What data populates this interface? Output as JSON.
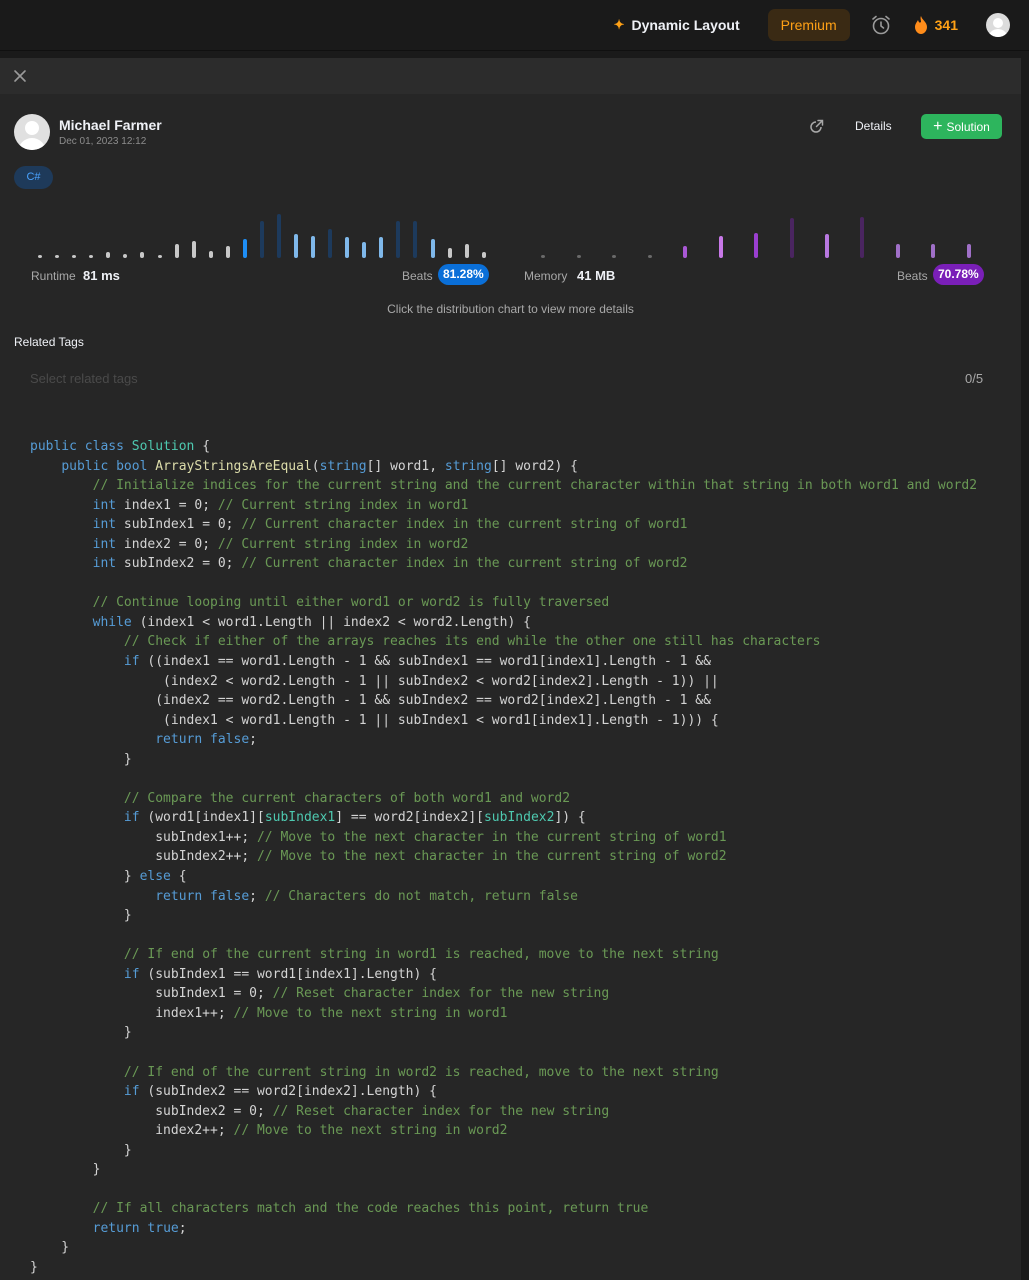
{
  "topbar": {
    "dynamic_layout": "Dynamic Layout",
    "premium": "Premium",
    "streak": "341"
  },
  "submission": {
    "author": "Michael Farmer",
    "date": "Dec 01, 2023 12:12",
    "details_label": "Details",
    "solution_label": "Solution",
    "language": "C#"
  },
  "stats": {
    "runtime_label": "Runtime",
    "runtime_value": "81 ms",
    "runtime_beats_label": "Beats",
    "runtime_beats": "81.28%",
    "memory_label": "Memory",
    "memory_value": "41 MB",
    "memory_beats_label": "Beats",
    "memory_beats": "70.78%",
    "hint": "Click the distribution chart to view more details"
  },
  "colors": {
    "runtime_accent": "#0a84ff",
    "memory_accent": "#8b2fd6",
    "solution_green": "#2db55d",
    "premium_orange": "#ffa116"
  },
  "related_tags": {
    "label": "Related Tags",
    "placeholder": "Select related tags",
    "count": "0/5"
  },
  "code_lines": [
    [
      [
        "kw",
        "public"
      ],
      [
        "p",
        " "
      ],
      [
        "kw",
        "class"
      ],
      [
        "p",
        " "
      ],
      [
        "ty",
        "Solution"
      ],
      [
        "p",
        " {"
      ]
    ],
    [
      [
        "p",
        "    "
      ],
      [
        "kw",
        "public"
      ],
      [
        "p",
        " "
      ],
      [
        "kw",
        "bool"
      ],
      [
        "p",
        " "
      ],
      [
        "fn",
        "ArrayStringsAreEqual"
      ],
      [
        "p",
        "("
      ],
      [
        "kw",
        "string"
      ],
      [
        "p",
        "[] word1, "
      ],
      [
        "kw",
        "string"
      ],
      [
        "p",
        "[] word2) {"
      ]
    ],
    [
      [
        "p",
        "        "
      ],
      [
        "cm",
        "// Initialize indices for the current string and the current character within that string in both word1 and word2"
      ]
    ],
    [
      [
        "p",
        "        "
      ],
      [
        "kw",
        "int"
      ],
      [
        "p",
        " index1 = 0; "
      ],
      [
        "cm",
        "// Current string index in word1"
      ]
    ],
    [
      [
        "p",
        "        "
      ],
      [
        "kw",
        "int"
      ],
      [
        "p",
        " subIndex1 = 0; "
      ],
      [
        "cm",
        "// Current character index in the current string of word1"
      ]
    ],
    [
      [
        "p",
        "        "
      ],
      [
        "kw",
        "int"
      ],
      [
        "p",
        " index2 = 0; "
      ],
      [
        "cm",
        "// Current string index in word2"
      ]
    ],
    [
      [
        "p",
        "        "
      ],
      [
        "kw",
        "int"
      ],
      [
        "p",
        " subIndex2 = 0; "
      ],
      [
        "cm",
        "// Current character index in the current string of word2"
      ]
    ],
    [
      [
        "p",
        ""
      ]
    ],
    [
      [
        "p",
        "        "
      ],
      [
        "cm",
        "// Continue looping until either word1 or word2 is fully traversed"
      ]
    ],
    [
      [
        "p",
        "        "
      ],
      [
        "kw",
        "while"
      ],
      [
        "p",
        " (index1 < word1.Length || index2 < word2.Length) {"
      ]
    ],
    [
      [
        "p",
        "            "
      ],
      [
        "cm",
        "// Check if either of the arrays reaches its end while the other one still has characters"
      ]
    ],
    [
      [
        "p",
        "            "
      ],
      [
        "kw",
        "if"
      ],
      [
        "p",
        " ((index1 == word1.Length - 1 && subIndex1 == word1[index1].Length - 1 &&"
      ]
    ],
    [
      [
        "p",
        "                 (index2 < word2.Length - 1 || subIndex2 < word2[index2].Length - 1)) ||"
      ]
    ],
    [
      [
        "p",
        "                (index2 == word2.Length - 1 && subIndex2 == word2[index2].Length - 1 &&"
      ]
    ],
    [
      [
        "p",
        "                 (index1 < word1.Length - 1 || subIndex1 < word1[index1].Length - 1))) {"
      ]
    ],
    [
      [
        "p",
        "                "
      ],
      [
        "kw",
        "return"
      ],
      [
        "p",
        " "
      ],
      [
        "kw",
        "false"
      ],
      [
        "p",
        ";"
      ]
    ],
    [
      [
        "p",
        "            }"
      ]
    ],
    [
      [
        "p",
        ""
      ]
    ],
    [
      [
        "p",
        "            "
      ],
      [
        "cm",
        "// Compare the current characters of both word1 and word2"
      ]
    ],
    [
      [
        "p",
        "            "
      ],
      [
        "kw",
        "if"
      ],
      [
        "p",
        " (word1[index1]["
      ],
      [
        "hl",
        "subIndex1"
      ],
      [
        "p",
        "] == word2[index2]["
      ],
      [
        "hl",
        "subIndex2"
      ],
      [
        "p",
        "]) {"
      ]
    ],
    [
      [
        "p",
        "                subIndex1++; "
      ],
      [
        "cm",
        "// Move to the next character in the current string of word1"
      ]
    ],
    [
      [
        "p",
        "                subIndex2++; "
      ],
      [
        "cm",
        "// Move to the next character in the current string of word2"
      ]
    ],
    [
      [
        "p",
        "            } "
      ],
      [
        "kw",
        "else"
      ],
      [
        "p",
        " {"
      ]
    ],
    [
      [
        "p",
        "                "
      ],
      [
        "kw",
        "return"
      ],
      [
        "p",
        " "
      ],
      [
        "kw",
        "false"
      ],
      [
        "p",
        "; "
      ],
      [
        "cm",
        "// Characters do not match, return false"
      ]
    ],
    [
      [
        "p",
        "            }"
      ]
    ],
    [
      [
        "p",
        ""
      ]
    ],
    [
      [
        "p",
        "            "
      ],
      [
        "cm",
        "// If end of the current string in word1 is reached, move to the next string"
      ]
    ],
    [
      [
        "p",
        "            "
      ],
      [
        "kw",
        "if"
      ],
      [
        "p",
        " (subIndex1 == word1[index1].Length) {"
      ]
    ],
    [
      [
        "p",
        "                subIndex1 = 0; "
      ],
      [
        "cm",
        "// Reset character index for the new string"
      ]
    ],
    [
      [
        "p",
        "                index1++; "
      ],
      [
        "cm",
        "// Move to the next string in word1"
      ]
    ],
    [
      [
        "p",
        "            }"
      ]
    ],
    [
      [
        "p",
        ""
      ]
    ],
    [
      [
        "p",
        "            "
      ],
      [
        "cm",
        "// If end of the current string in word2 is reached, move to the next string"
      ]
    ],
    [
      [
        "p",
        "            "
      ],
      [
        "kw",
        "if"
      ],
      [
        "p",
        " (subIndex2 == word2[index2].Length) {"
      ]
    ],
    [
      [
        "p",
        "                subIndex2 = 0; "
      ],
      [
        "cm",
        "// Reset character index for the new string"
      ]
    ],
    [
      [
        "p",
        "                index2++; "
      ],
      [
        "cm",
        "// Move to the next string in word2"
      ]
    ],
    [
      [
        "p",
        "            }"
      ]
    ],
    [
      [
        "p",
        "        }"
      ]
    ],
    [
      [
        "p",
        ""
      ]
    ],
    [
      [
        "p",
        "        "
      ],
      [
        "cm",
        "// If all characters match and the code reaches this point, return true"
      ]
    ],
    [
      [
        "p",
        "        "
      ],
      [
        "kw",
        "return"
      ],
      [
        "p",
        " "
      ],
      [
        "kw",
        "true"
      ],
      [
        "p",
        ";"
      ]
    ],
    [
      [
        "p",
        "    }"
      ]
    ],
    [
      [
        "p",
        "}"
      ]
    ]
  ]
}
